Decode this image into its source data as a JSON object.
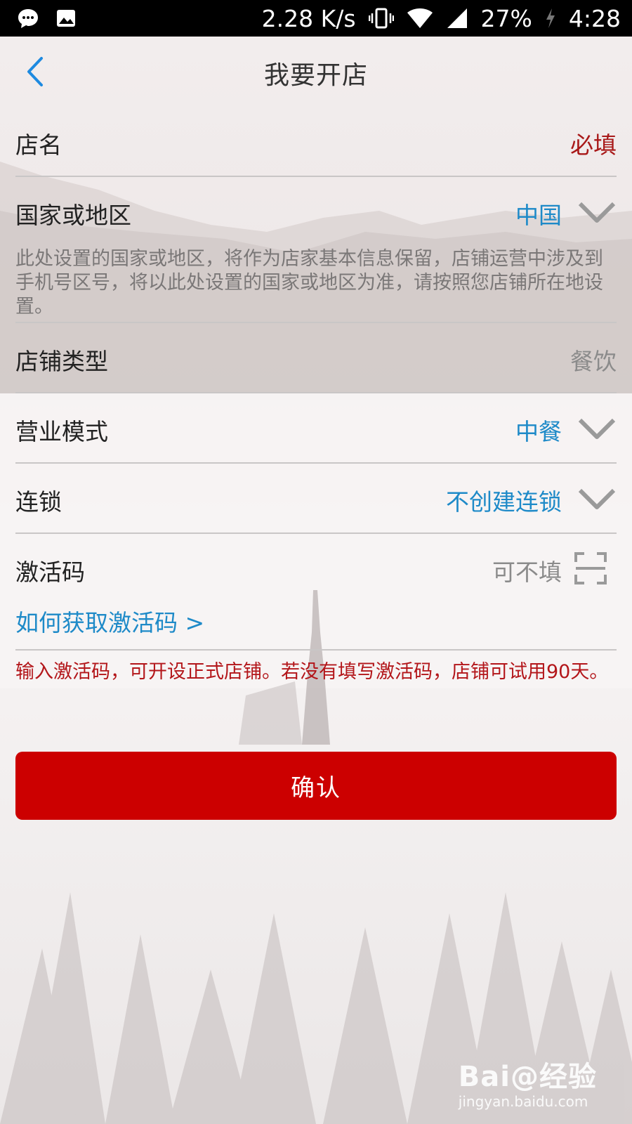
{
  "status_bar": {
    "speed": "2.28 K/s",
    "battery": "27%",
    "time": "4:28"
  },
  "header": {
    "title": "我要开店"
  },
  "form": {
    "shop_name": {
      "label": "店名",
      "value": "必填"
    },
    "country": {
      "label": "国家或地区",
      "value": "中国",
      "hint": "此处设置的国家或地区，将作为店家基本信息保留，店铺运营中涉及到手机号区号，将以此处设置的国家或地区为准，请按照您店铺所在地设置。"
    },
    "shop_type": {
      "label": "店铺类型",
      "value": "餐饮"
    },
    "business_mode": {
      "label": "营业模式",
      "value": "中餐"
    },
    "chain": {
      "label": "连锁",
      "value": "不创建连锁"
    },
    "activation": {
      "label": "激活码",
      "placeholder": "可不填",
      "help_link": "如何获取激活码 >",
      "notice": "输入激活码，可开设正式店铺。若没有填写激活码，店铺可试用90天。"
    }
  },
  "confirm_label": "确认",
  "watermark": {
    "logo": "Bai@经验",
    "url": "jingyan.baidu.com"
  },
  "colors": {
    "accent_red": "#cc0000",
    "link_blue": "#1e8ac8",
    "required_red": "#a81818"
  }
}
